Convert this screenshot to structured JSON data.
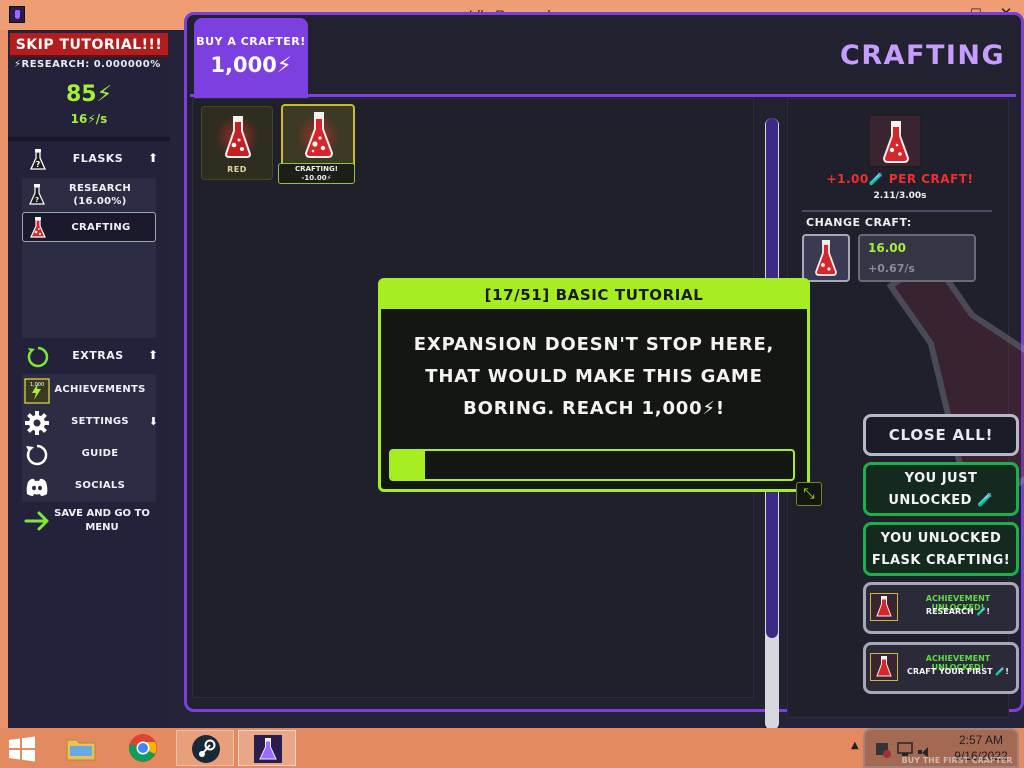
{
  "window": {
    "title": "Idle Research",
    "minimize": "—",
    "maximize": "☐",
    "close": "✕"
  },
  "sidebar": {
    "skip_tutorial": "SKIP TUTORIAL!!!",
    "research_line": "⚡RESEARCH: 0.000000%",
    "energy": "85⚡",
    "energy_rate": "16⚡/s",
    "flasks_section": {
      "label": "FLASKS",
      "arrow": "⬆"
    },
    "flask_items": [
      {
        "label": "RESEARCH\n(16.00%)",
        "icon": "flask-question-icon"
      },
      {
        "label": "CRAFTING",
        "icon": "red-flask-icon"
      }
    ],
    "extras_section": {
      "label": "EXTRAS",
      "arrow": "⬆"
    },
    "extras_items": [
      {
        "label": "ACHIEVEMENTS",
        "icon": "achievement-badge-icon",
        "badge": "1,000"
      },
      {
        "label": "SETTINGS",
        "icon": "gear-icon",
        "arrow": "⬇"
      },
      {
        "label": "GUIDE",
        "icon": "refresh-icon"
      },
      {
        "label": "SOCIALS",
        "icon": "discord-icon"
      }
    ],
    "save_menu": "SAVE AND GO TO MENU"
  },
  "main": {
    "buy_crafter": {
      "label": "BUY A CRAFTER!",
      "cost": "1,000⚡"
    },
    "section_title": "CRAFTING",
    "crafters": [
      {
        "caption": "RED",
        "icon": "red-flask-icon"
      },
      {
        "caption": "",
        "icon": "red-flask-icon",
        "status_line1": "CRAFTING!",
        "status_line2": "-10.00⚡"
      }
    ],
    "scrollbar": {
      "position": 0.0,
      "visible_fraction": 0.85
    }
  },
  "detail": {
    "per_craft": "+1.00🧪 PER CRAFT!",
    "time": "2.11/3.00s",
    "change_craft_label": "CHANGE CRAFT:",
    "craft_amount": "16.00",
    "craft_rate": "+0.67/s"
  },
  "tutorial": {
    "header": "[17/51] BASIC TUTORIAL",
    "body": "EXPANSION DOESN'T STOP HERE, THAT WOULD MAKE THIS GAME BORING. REACH 1,000⚡!",
    "progress": 0.085,
    "resize_glyph": "⤡"
  },
  "notifications": {
    "close_all": "CLOSE ALL!",
    "items": [
      {
        "kind": "unlock",
        "text": "YOU JUST UNLOCKED 🧪"
      },
      {
        "kind": "unlock",
        "text": "YOU UNLOCKED FLASK CRAFTING!"
      },
      {
        "kind": "achievement",
        "title": "ACHIEVEMENT UNLOCKED!",
        "text": "RESEARCH 🧪!"
      },
      {
        "kind": "achievement",
        "title": "ACHIEVEMENT UNLOCKED!",
        "text": "CRAFT YOUR FIRST 🧪!"
      }
    ],
    "ghost_text": "BUY THE FIRST CRAFTER"
  },
  "taskbar": {
    "apps": [
      {
        "name": "file-explorer",
        "icon": "folder-icon"
      },
      {
        "name": "chrome",
        "icon": "chrome-icon"
      },
      {
        "name": "steam",
        "icon": "steam-icon"
      },
      {
        "name": "idle-research",
        "icon": "idle-research-icon"
      }
    ],
    "tray_arrow": "▲",
    "time": "2:57 AM",
    "date": "9/16/2022"
  },
  "colors": {
    "accent_purple": "#7c3fe0",
    "energy_green": "#a6ef3a",
    "skip_red": "#b41d1d",
    "notif_green": "#1bb04a",
    "crafting_title": "#c69dff",
    "taskbar": "#e38a60"
  }
}
